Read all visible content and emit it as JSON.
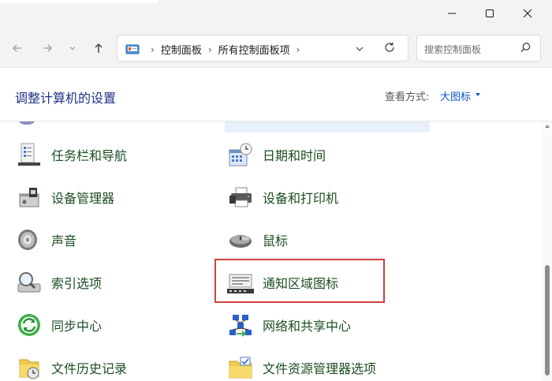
{
  "window": {
    "minimize_icon": "minimize-icon",
    "maximize_icon": "maximize-icon",
    "close_icon": "close-icon"
  },
  "navigation": {
    "back_icon": "arrow-left-icon",
    "forward_icon": "arrow-right-icon",
    "history_icon": "chevron-down-icon",
    "up_icon": "arrow-up-icon"
  },
  "address_bar": {
    "crumbs": [
      "控制面板",
      "所有控制面板项"
    ],
    "refresh_icon": "refresh-icon"
  },
  "search": {
    "placeholder": "搜索控制面板"
  },
  "header": {
    "title": "调整计算机的设置",
    "view_by_label": "查看方式:",
    "view_by_value": "大图标"
  },
  "items": [
    {
      "label": "任务栏和导航",
      "icon": "taskbar-icon"
    },
    {
      "label": "日期和时间",
      "icon": "calendar-clock-icon"
    },
    {
      "label": "设备管理器",
      "icon": "device-manager-icon"
    },
    {
      "label": "设备和打印机",
      "icon": "printer-icon"
    },
    {
      "label": "声音",
      "icon": "speaker-icon"
    },
    {
      "label": "鼠标",
      "icon": "mouse-icon"
    },
    {
      "label": "索引选项",
      "icon": "indexing-icon"
    },
    {
      "label": "通知区域图标",
      "icon": "notification-area-icon"
    },
    {
      "label": "同步中心",
      "icon": "sync-icon"
    },
    {
      "label": "网络和共享中心",
      "icon": "network-icon"
    },
    {
      "label": "文件历史记录",
      "icon": "file-history-icon"
    },
    {
      "label": "文件资源管理器选项",
      "icon": "folder-options-icon"
    }
  ],
  "colors": {
    "item_text": "#1b4d22",
    "title_text": "#1e3287",
    "highlight_border": "#cf4040",
    "link": "#0b57d0"
  }
}
